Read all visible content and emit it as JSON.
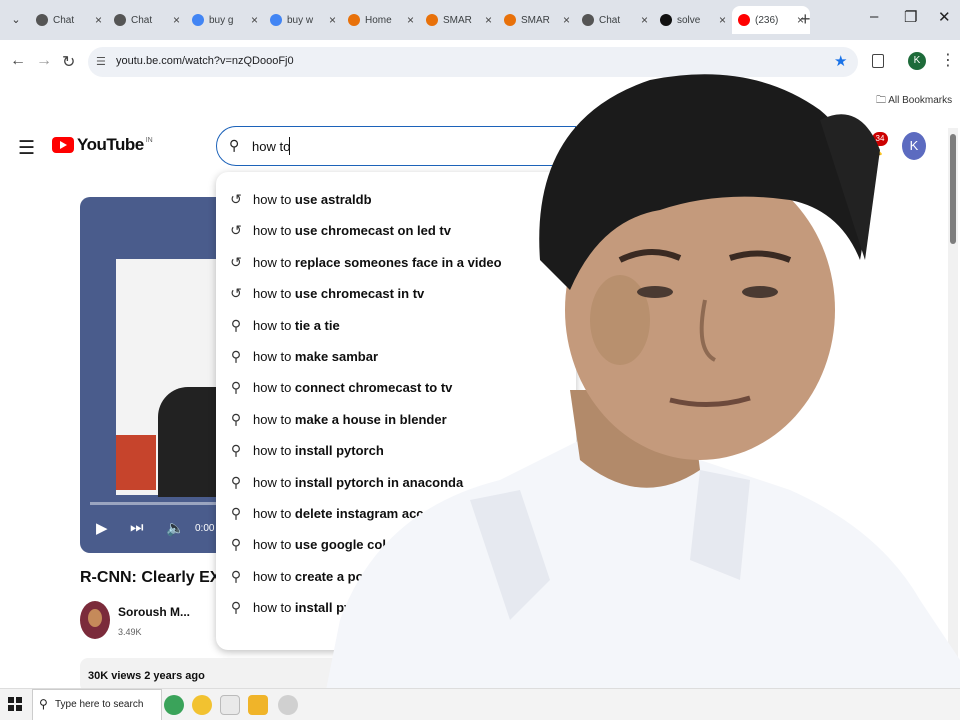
{
  "browser": {
    "tabs": [
      {
        "label": "Chat",
        "favicon": "chatgpt-icon",
        "color": "#555555"
      },
      {
        "label": "Chat",
        "favicon": "chatgpt-icon",
        "color": "#555555"
      },
      {
        "label": "buy g",
        "favicon": "google-icon",
        "color": "#4285f4"
      },
      {
        "label": "buy w",
        "favicon": "google-icon",
        "color": "#4285f4"
      },
      {
        "label": "Home",
        "favicon": "home-icon",
        "color": "#e8710a"
      },
      {
        "label": "SMAR",
        "favicon": "smart-icon",
        "color": "#e8710a"
      },
      {
        "label": "SMAR",
        "favicon": "smart-icon",
        "color": "#e8710a"
      },
      {
        "label": "Chat",
        "favicon": "chatgpt-icon",
        "color": "#555555"
      },
      {
        "label": "solve",
        "favicon": "github-icon",
        "color": "#111111"
      },
      {
        "label": "(236)",
        "favicon": "youtube-icon",
        "color": "#ff0000",
        "active": true
      }
    ],
    "url": "youtu.be.com/watch?v=nzQDoooFj0",
    "bookmarks_label": "All Bookmarks",
    "profile_initial": "K"
  },
  "youtube": {
    "logo_text": "YouTube",
    "logo_country": "IN",
    "search_query": "how to",
    "notification_count": "34",
    "avatar_initial": "K",
    "suggestions": [
      {
        "prefix": "how to ",
        "rest": "use astraldb",
        "type": "history"
      },
      {
        "prefix": "how to ",
        "rest": "use chromecast on led tv",
        "type": "history"
      },
      {
        "prefix": "how to ",
        "rest": "replace someones face in a video",
        "type": "history"
      },
      {
        "prefix": "how to ",
        "rest": "use chromecast in tv",
        "type": "history"
      },
      {
        "prefix": "how to ",
        "rest": "tie a tie",
        "type": "search"
      },
      {
        "prefix": "how to ",
        "rest": "make sambar",
        "type": "search"
      },
      {
        "prefix": "how to ",
        "rest": "connect chromecast to tv",
        "type": "search"
      },
      {
        "prefix": "how to ",
        "rest": "make a house in blender",
        "type": "search"
      },
      {
        "prefix": "how to ",
        "rest": "install pytorch",
        "type": "search"
      },
      {
        "prefix": "how to ",
        "rest": "install pytorch in anaconda",
        "type": "search"
      },
      {
        "prefix": "how to ",
        "rest": "delete instagram account",
        "type": "search"
      },
      {
        "prefix": "how to ",
        "rest": "use google colab",
        "type": "search"
      },
      {
        "prefix": "how to ",
        "rest": "create a pod",
        "type": "search"
      },
      {
        "prefix": "how to ",
        "rest": "install py",
        "type": "search"
      }
    ],
    "video": {
      "time": "0:00",
      "title": "R-CNN: Clearly EXPL",
      "channel": "Soroush M...",
      "subscribers": "3.49K",
      "meta": "30K views  2 years ago"
    }
  },
  "taskbar": {
    "search_placeholder": "Type here to search"
  }
}
